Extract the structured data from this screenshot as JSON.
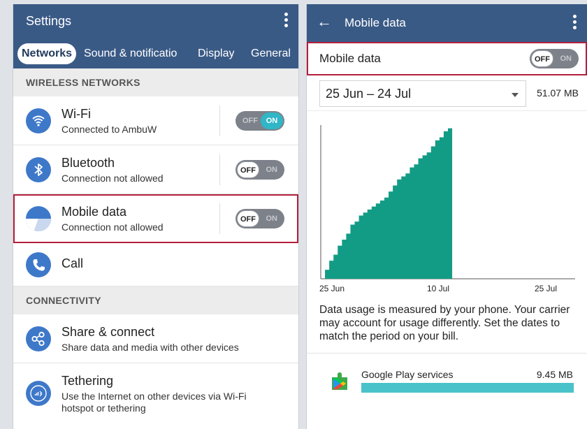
{
  "left": {
    "header": {
      "title": "Settings"
    },
    "tabs": [
      "Networks",
      "Sound & notificatio",
      "Display",
      "General"
    ],
    "wireless": {
      "heading": "WIRELESS NETWORKS",
      "items": [
        {
          "title": "Wi-Fi",
          "subtitle": "Connected to AmbuW",
          "icon": "wifi-icon",
          "toggle": {
            "state": "ON",
            "off_label": "OFF",
            "on_label": "ON"
          }
        },
        {
          "title": "Bluetooth",
          "subtitle": "Connection not allowed",
          "icon": "bluetooth-icon",
          "toggle": {
            "state": "OFF",
            "off_label": "OFF",
            "on_label": "ON"
          }
        },
        {
          "title": "Mobile data",
          "subtitle": "Connection not allowed",
          "icon": "mobile-data-icon",
          "toggle": {
            "state": "OFF",
            "off_label": "OFF",
            "on_label": "ON"
          }
        },
        {
          "title": "Call",
          "icon": "phone-icon"
        }
      ]
    },
    "connectivity": {
      "heading": "CONNECTIVITY",
      "items": [
        {
          "title": "Share & connect",
          "subtitle": "Share data and media with other devices",
          "icon": "share-icon"
        },
        {
          "title": "Tethering",
          "subtitle_line1": "Use the Internet on other devices via Wi-Fi",
          "subtitle_line2": "hotspot or tethering",
          "icon": "tethering-icon"
        }
      ]
    }
  },
  "right": {
    "header": {
      "title": "Mobile data"
    },
    "mobile_data": {
      "label": "Mobile data",
      "toggle": {
        "state": "OFF",
        "off_label": "OFF",
        "on_label": "ON"
      }
    },
    "period": {
      "range": "25 Jun – 24 Jul",
      "total": "51.07 MB"
    },
    "description": "Data usage is measured by your phone. Your carrier may account for usage differently. Set the dates to match the period on your bill.",
    "apps": [
      {
        "name": "Google Play services",
        "size": "9.45 MB",
        "icon": "google-play-icon",
        "share": 1.0
      }
    ]
  },
  "colors": {
    "appbar": "#3a5a86",
    "accent": "#30b6c7",
    "chart_fill": "#139c85",
    "highlight": "#b3203c"
  },
  "chart_data": {
    "type": "area",
    "x_tick_labels": [
      "25 Jun",
      "10 Jul",
      "25 Jul"
    ],
    "x_unit": "days since 25 Jun",
    "xlim": [
      0,
      30
    ],
    "ylim": [
      0,
      51.07
    ],
    "series": [
      {
        "points": [
          [
            0,
            0
          ],
          [
            0.5,
            3
          ],
          [
            1,
            6
          ],
          [
            1.5,
            8
          ],
          [
            2,
            11
          ],
          [
            2.5,
            13
          ],
          [
            3,
            15
          ],
          [
            3.5,
            18
          ],
          [
            4,
            19
          ],
          [
            4.5,
            21
          ],
          [
            5,
            22
          ],
          [
            5.5,
            23
          ],
          [
            6,
            24
          ],
          [
            6.5,
            25
          ],
          [
            7,
            26
          ],
          [
            7.5,
            27
          ],
          [
            8,
            29
          ],
          [
            8.5,
            31
          ],
          [
            9,
            33
          ],
          [
            9.5,
            34
          ],
          [
            10,
            35
          ],
          [
            10.5,
            37
          ],
          [
            11,
            38
          ],
          [
            11.5,
            40
          ],
          [
            12,
            41
          ],
          [
            12.5,
            42
          ],
          [
            13,
            44
          ],
          [
            13.5,
            46
          ],
          [
            14,
            47
          ],
          [
            14.5,
            49
          ],
          [
            15,
            50
          ],
          [
            15.5,
            51
          ]
        ]
      }
    ]
  }
}
